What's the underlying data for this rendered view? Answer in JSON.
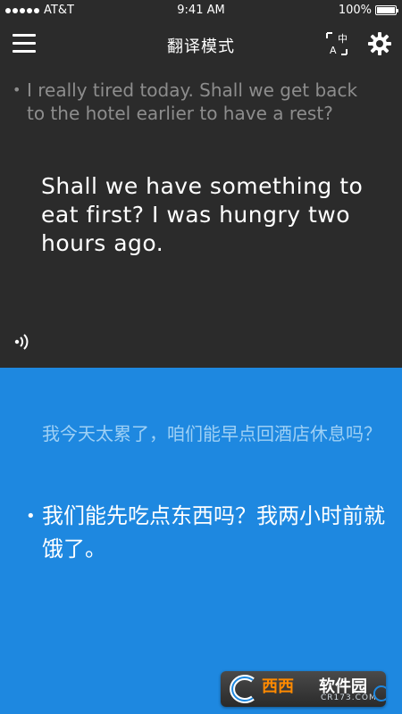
{
  "status_bar": {
    "carrier": "AT&T",
    "time": "9:41 AM",
    "battery": "100%",
    "battery_level": 1.0
  },
  "nav": {
    "title": "翻译模式",
    "menu_icon": "hamburger-menu-icon",
    "lang_icon": "language-switch-icon",
    "settings_icon": "gear-icon"
  },
  "english_panel": {
    "previous": "I really tired today. Shall we get back to the hotel earlier to have a rest?",
    "current": "Shall we have something to eat first? I was hungry two hours ago.",
    "speaker_icon": "speaker-icon"
  },
  "chinese_panel": {
    "previous": "我今天太累了，咱们能早点回酒店休息吗？",
    "current": "我们能先吃点东西吗？我两小时前就饿了。"
  },
  "watermark": {
    "brand_a": "西西",
    "brand_b": "软件园",
    "domain": "CR173.COM"
  },
  "colors": {
    "dark_bg": "#2b2b2b",
    "blue_bg": "#1e88e0",
    "muted_gray": "#8d8d8d",
    "muted_blue": "#9ed0f5"
  }
}
